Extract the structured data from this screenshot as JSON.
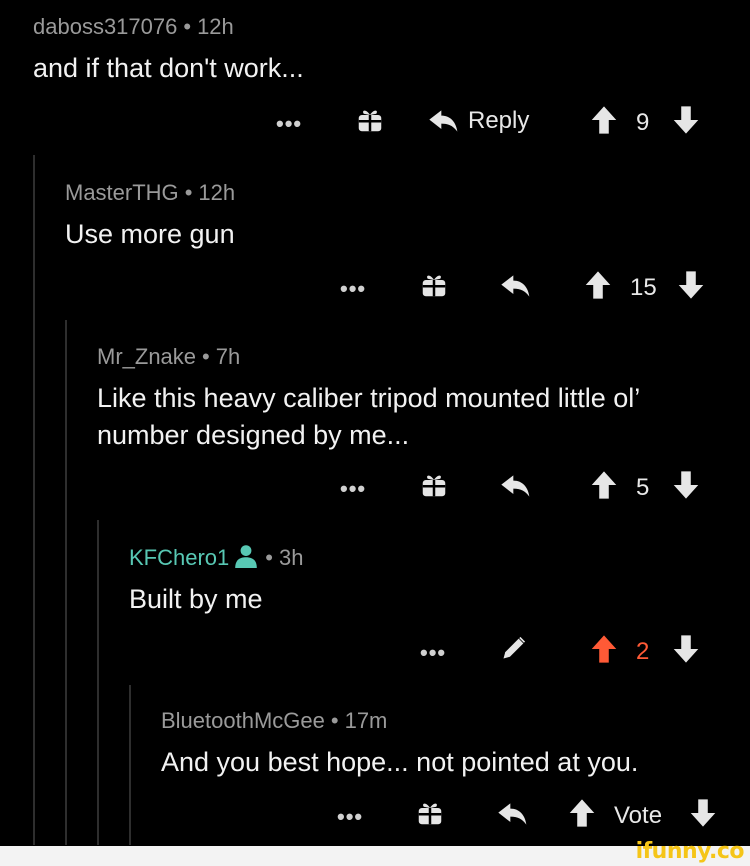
{
  "comments": [
    {
      "author": "daboss317076",
      "time": "12h",
      "text": "and if that don't work...",
      "more": "•••",
      "reply_label": "Reply",
      "votes": "9"
    },
    {
      "author": "MasterTHG",
      "time": "12h",
      "text": "Use more gun",
      "more": "•••",
      "votes": "15"
    },
    {
      "author": "Mr_Znake",
      "time": "7h",
      "text": "Like this heavy caliber tripod mounted little ol’ number designed by me...",
      "more": "•••",
      "votes": "5"
    },
    {
      "author": "KFChero1",
      "time": "3h",
      "text": "Built by me",
      "more": "•••",
      "votes": "2",
      "upvoted": true,
      "is_op": true
    },
    {
      "author": "BluetoothMcGee",
      "time": "17m",
      "text": "And you best hope... not pointed at you.",
      "more": "•••",
      "vote_label": "Vote"
    }
  ],
  "separator": "•",
  "brand": "ifunny.co",
  "colors": {
    "background": "#000000",
    "op_author": "#58c8b4",
    "upvote_active": "#ff5a36",
    "meta_text": "#9a9a9a"
  },
  "icons": [
    "more-icon",
    "gift-icon",
    "reply-icon",
    "upvote-icon",
    "downvote-icon",
    "edit-icon",
    "op-person-icon"
  ]
}
